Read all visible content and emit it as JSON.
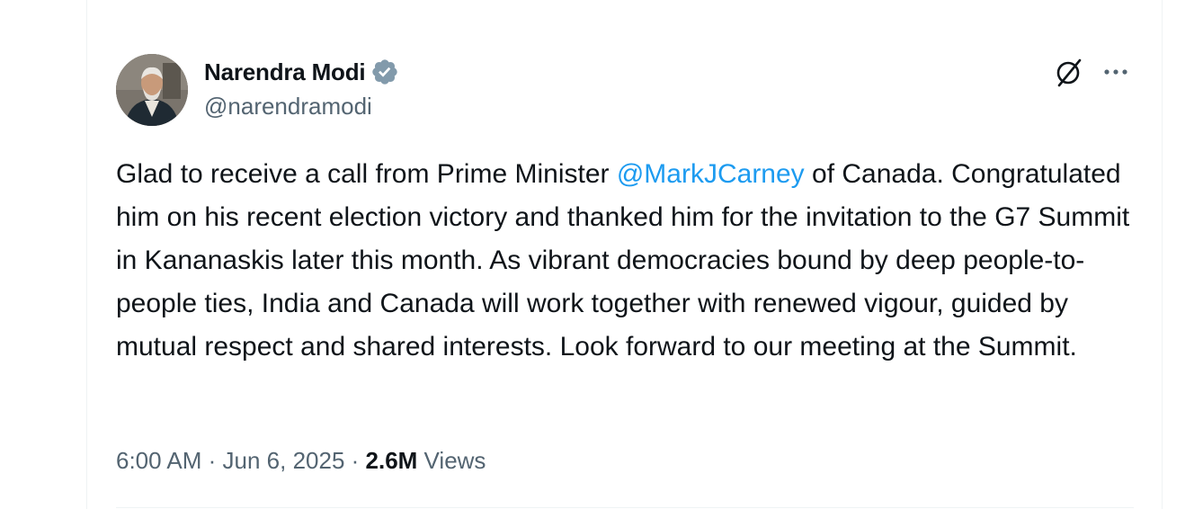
{
  "author": {
    "display_name": "Narendra Modi",
    "handle": "@narendramodi",
    "verified": true,
    "verified_badge_color": "#829aab"
  },
  "header_actions": {
    "grok_icon": "grok-slash-circle-icon",
    "more_icon": "more-horizontal-icon"
  },
  "tweet": {
    "text_before_mention": "Glad to receive a call from Prime Minister ",
    "mention": "@MarkJCarney",
    "text_after_mention": " of Canada. Congratulated him on his recent election victory and thanked him for the invitation to the G7 Summit in Kananaskis later this month. As vibrant democracies bound by deep people-to-people ties, India and Canada will work together with renewed vigour, guided by mutual respect and shared interests. Look forward to our meeting at the Summit.",
    "mention_color": "#1d9bf0"
  },
  "meta": {
    "time": "6:00 AM",
    "separator": " · ",
    "date": "Jun 6, 2025",
    "views_count": "2.6M",
    "views_label": " Views"
  },
  "colors": {
    "text_primary": "#0f1419",
    "text_secondary": "#536471",
    "border": "#eff3f4"
  }
}
